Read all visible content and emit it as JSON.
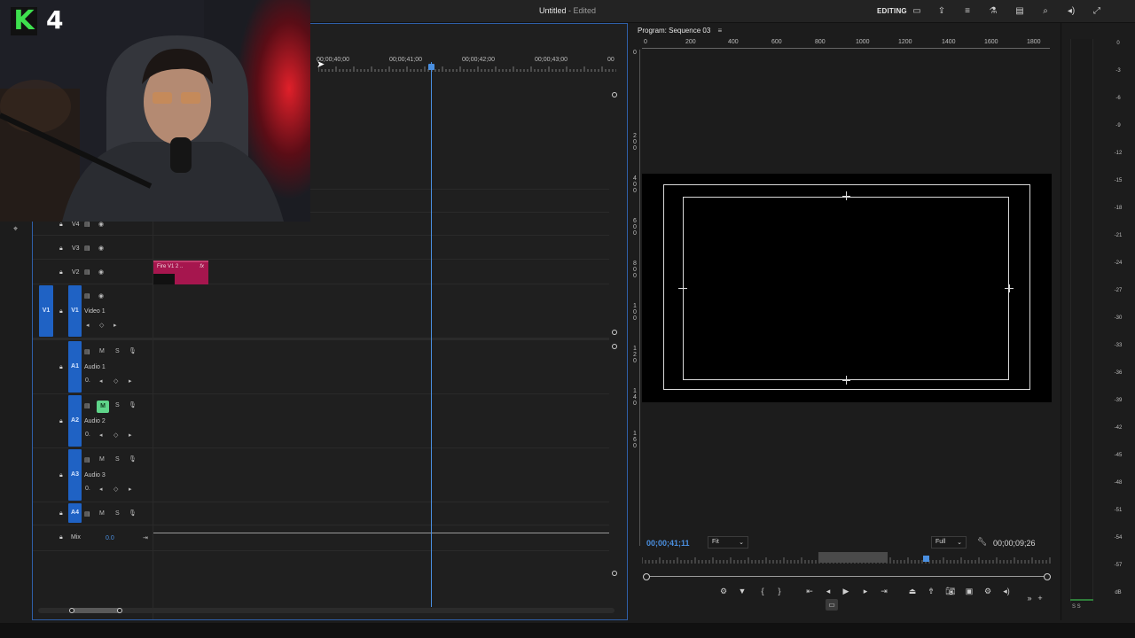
{
  "window": {
    "title": "Untitled",
    "title_suffix": "- Edited",
    "workspace": "EDITING"
  },
  "webcam": {
    "badge_letter": "K",
    "badge_number": "4"
  },
  "timeline": {
    "ruler": [
      "00;00;40;00",
      "00;00;41;00",
      "00;00;42;00",
      "00;00;43;00",
      "00"
    ],
    "video_tracks": [
      {
        "id": "V4",
        "name": ""
      },
      {
        "id": "V3",
        "name": ""
      },
      {
        "id": "V2",
        "name": ""
      },
      {
        "id": "V1",
        "name": "Video 1",
        "source": "V1"
      }
    ],
    "audio_tracks": [
      {
        "id": "A1",
        "name": "Audio 1",
        "level": "0."
      },
      {
        "id": "A2",
        "name": "Audio 2",
        "level": "0."
      },
      {
        "id": "A3",
        "name": "Audio 3",
        "level": "0."
      },
      {
        "id": "A4",
        "name": ""
      }
    ],
    "mix": {
      "label": "Mix",
      "value": "0.0"
    },
    "clip": {
      "label": "Fire V1 2 ..",
      "fx": "fx"
    },
    "btn_m": "M",
    "btn_s": "S"
  },
  "program": {
    "title": "Program: Sequence 03",
    "ruler": [
      "0",
      "200",
      "400",
      "600",
      "800",
      "1000",
      "1200",
      "1400",
      "1600",
      "1800"
    ],
    "left_ruler": [
      "0",
      "2 0 0",
      "4 0 0",
      "6 0 0",
      "8 0 0",
      "1 0 0",
      "1 2 0",
      "1 4 0",
      "1 6 0"
    ],
    "timecode_in": "00;00;41;11",
    "timecode_out": "00;00;09;26",
    "fit": "Fit",
    "quality": "Full"
  },
  "meter": {
    "scale": [
      "0",
      "-3",
      "-6",
      "-9",
      "-12",
      "-15",
      "-18",
      "-21",
      "-24",
      "-27",
      "-30",
      "-33",
      "-36",
      "-39",
      "-42",
      "-45",
      "-48",
      "-51",
      "-54",
      "-57",
      "dB"
    ],
    "channels": "S  S"
  }
}
